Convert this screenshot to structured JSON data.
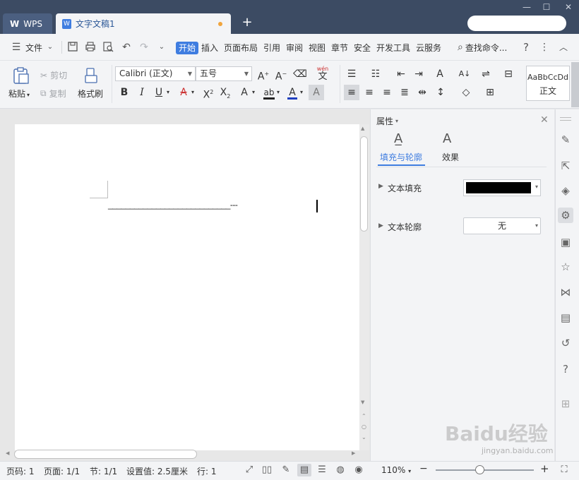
{
  "titlebar": {
    "wps_tab": "WPS",
    "doc_tab": "文字文稿1",
    "new_tab": "+"
  },
  "menu": {
    "file": "文件",
    "items": [
      "开始",
      "插入",
      "页面布局",
      "引用",
      "审阅",
      "视图",
      "章节",
      "安全",
      "开发工具",
      "云服务"
    ],
    "active": "开始",
    "search": "查找命令...",
    "help": "?"
  },
  "ribbon": {
    "paste": "粘贴",
    "cut": "剪切",
    "copy": "复制",
    "format_painter": "格式刷",
    "font_name": "Calibri (正文)",
    "font_size": "五号",
    "style_preview": "AaBbCcDd",
    "style_name": "正文",
    "wen_char": "wén"
  },
  "document": {
    "text": "____________________________---"
  },
  "panel": {
    "title": "属性",
    "tab_fill": "填充与轮廓",
    "tab_effect": "效果",
    "text_fill_label": "文本填充",
    "text_fill_color": "#000000",
    "text_outline_label": "文本轮廓",
    "text_outline_value": "无"
  },
  "statusbar": {
    "page_num": "页码: 1",
    "pages": "页面: 1/1",
    "section": "节: 1/1",
    "setting": "设置值: 2.5厘米",
    "row": "行: 1",
    "zoom": "110%",
    "zoom_fraction": 0.45
  },
  "watermark": {
    "brand": "Baidu经验",
    "url": "jingyan.baidu.com"
  },
  "colors": {
    "accent": "#3f7de0",
    "titlebar": "#3c4b63",
    "font_color_bar": "#1f3fbf"
  }
}
